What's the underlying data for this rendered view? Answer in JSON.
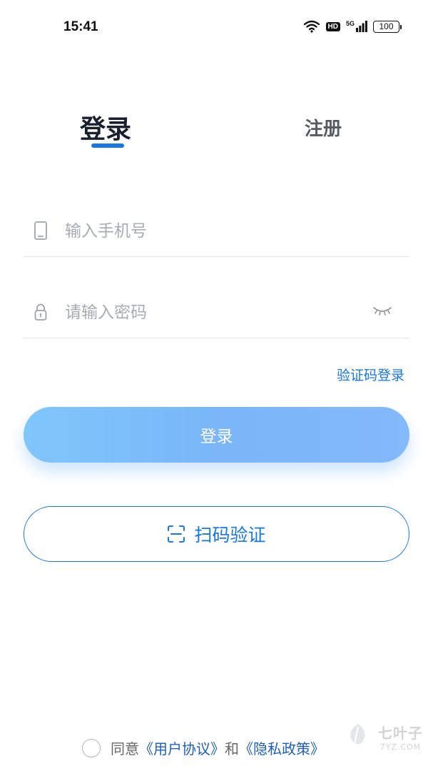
{
  "status_bar": {
    "time": "15:41",
    "hd": "HD",
    "network": "5G",
    "battery": "100",
    "icons": [
      "wifi-icon",
      "hd-icon",
      "signal-icon",
      "battery-icon"
    ]
  },
  "tabs": {
    "login": "登录",
    "register": "注册",
    "active": "login"
  },
  "form": {
    "phone_placeholder": "输入手机号",
    "password_placeholder": "请输入密码",
    "code_login_link": "验证码登录",
    "login_button": "登录",
    "scan_button": "扫码验证"
  },
  "agreement": {
    "agree_text": "同意",
    "user_agreement": "《用户协议》",
    "and_text": "和",
    "privacy_policy": "《隐私政策》",
    "checked": false
  },
  "watermark": {
    "name": "七叶子",
    "domain": "7YZ.COM"
  },
  "colors": {
    "accent": "#1677e6",
    "button_gradient_start": "#7fc6fb",
    "button_gradient_end": "#84b9fb",
    "placeholder": "#a7abb2"
  }
}
